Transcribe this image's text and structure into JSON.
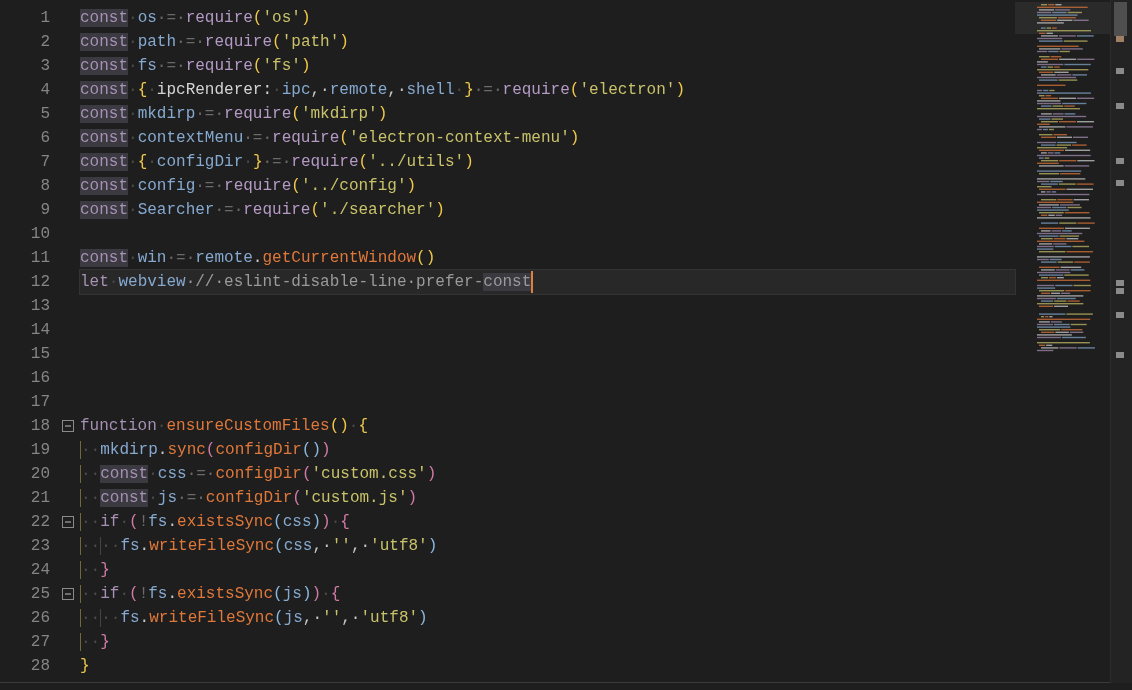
{
  "editor": {
    "lines": [
      {
        "number": "1",
        "fold": false,
        "current": false,
        "segments": [
          {
            "text": "const",
            "kind": "kw-match"
          },
          {
            "text": "·",
            "kind": "ws"
          },
          {
            "text": "os",
            "kind": "id"
          },
          {
            "text": "·=·",
            "kind": "op"
          },
          {
            "text": "require",
            "kind": "call"
          },
          {
            "text": "(",
            "kind": "p1"
          },
          {
            "text": "'os'",
            "kind": "str"
          },
          {
            "text": ")",
            "kind": "p1"
          }
        ]
      },
      {
        "number": "2",
        "fold": false,
        "current": false,
        "segments": [
          {
            "text": "const",
            "kind": "kw-match"
          },
          {
            "text": "·",
            "kind": "ws"
          },
          {
            "text": "path",
            "kind": "id"
          },
          {
            "text": "·=·",
            "kind": "op"
          },
          {
            "text": "require",
            "kind": "call"
          },
          {
            "text": "(",
            "kind": "p1"
          },
          {
            "text": "'path'",
            "kind": "str"
          },
          {
            "text": ")",
            "kind": "p1"
          }
        ]
      },
      {
        "number": "3",
        "fold": false,
        "current": false,
        "segments": [
          {
            "text": "const",
            "kind": "kw-match"
          },
          {
            "text": "·",
            "kind": "ws"
          },
          {
            "text": "fs",
            "kind": "id"
          },
          {
            "text": "·=·",
            "kind": "op"
          },
          {
            "text": "require",
            "kind": "call"
          },
          {
            "text": "(",
            "kind": "p1"
          },
          {
            "text": "'fs'",
            "kind": "str"
          },
          {
            "text": ")",
            "kind": "p1"
          }
        ]
      },
      {
        "number": "4",
        "fold": false,
        "current": false,
        "segments": [
          {
            "text": "const",
            "kind": "kw-match"
          },
          {
            "text": "·",
            "kind": "ws"
          },
          {
            "text": "{",
            "kind": "p1"
          },
          {
            "text": "·",
            "kind": "ws"
          },
          {
            "text": "ipcRenderer:",
            "kind": "prop"
          },
          {
            "text": "·",
            "kind": "ws"
          },
          {
            "text": "ipc",
            "kind": "id"
          },
          {
            "text": ",·",
            "kind": "punc"
          },
          {
            "text": "remote",
            "kind": "id"
          },
          {
            "text": ",·",
            "kind": "punc"
          },
          {
            "text": "shell",
            "kind": "id"
          },
          {
            "text": "·",
            "kind": "ws"
          },
          {
            "text": "}",
            "kind": "p1"
          },
          {
            "text": "·=·",
            "kind": "op"
          },
          {
            "text": "require",
            "kind": "call"
          },
          {
            "text": "(",
            "kind": "p1"
          },
          {
            "text": "'electron'",
            "kind": "str"
          },
          {
            "text": ")",
            "kind": "p1"
          }
        ]
      },
      {
        "number": "5",
        "fold": false,
        "current": false,
        "segments": [
          {
            "text": "const",
            "kind": "kw-match"
          },
          {
            "text": "·",
            "kind": "ws"
          },
          {
            "text": "mkdirp",
            "kind": "id"
          },
          {
            "text": "·=·",
            "kind": "op"
          },
          {
            "text": "require",
            "kind": "call"
          },
          {
            "text": "(",
            "kind": "p1"
          },
          {
            "text": "'mkdirp'",
            "kind": "str"
          },
          {
            "text": ")",
            "kind": "p1"
          }
        ]
      },
      {
        "number": "6",
        "fold": false,
        "current": false,
        "segments": [
          {
            "text": "const",
            "kind": "kw-match"
          },
          {
            "text": "·",
            "kind": "ws"
          },
          {
            "text": "contextMenu",
            "kind": "id"
          },
          {
            "text": "·=·",
            "kind": "op"
          },
          {
            "text": "require",
            "kind": "call"
          },
          {
            "text": "(",
            "kind": "p1"
          },
          {
            "text": "'electron-context-menu'",
            "kind": "str"
          },
          {
            "text": ")",
            "kind": "p1"
          }
        ]
      },
      {
        "number": "7",
        "fold": false,
        "current": false,
        "segments": [
          {
            "text": "const",
            "kind": "kw-match"
          },
          {
            "text": "·",
            "kind": "ws"
          },
          {
            "text": "{",
            "kind": "p1"
          },
          {
            "text": "·",
            "kind": "ws"
          },
          {
            "text": "configDir",
            "kind": "id"
          },
          {
            "text": "·",
            "kind": "ws"
          },
          {
            "text": "}",
            "kind": "p1"
          },
          {
            "text": "·=·",
            "kind": "op"
          },
          {
            "text": "require",
            "kind": "call"
          },
          {
            "text": "(",
            "kind": "p1"
          },
          {
            "text": "'../utils'",
            "kind": "str"
          },
          {
            "text": ")",
            "kind": "p1"
          }
        ]
      },
      {
        "number": "8",
        "fold": false,
        "current": false,
        "segments": [
          {
            "text": "const",
            "kind": "kw-match"
          },
          {
            "text": "·",
            "kind": "ws"
          },
          {
            "text": "config",
            "kind": "id"
          },
          {
            "text": "·=·",
            "kind": "op"
          },
          {
            "text": "require",
            "kind": "call"
          },
          {
            "text": "(",
            "kind": "p1"
          },
          {
            "text": "'../config'",
            "kind": "str"
          },
          {
            "text": ")",
            "kind": "p1"
          }
        ]
      },
      {
        "number": "9",
        "fold": false,
        "current": false,
        "segments": [
          {
            "text": "const",
            "kind": "kw-match"
          },
          {
            "text": "·",
            "kind": "ws"
          },
          {
            "text": "Searcher",
            "kind": "id"
          },
          {
            "text": "·=·",
            "kind": "op"
          },
          {
            "text": "require",
            "kind": "call"
          },
          {
            "text": "(",
            "kind": "p1"
          },
          {
            "text": "'./searcher'",
            "kind": "str"
          },
          {
            "text": ")",
            "kind": "p1"
          }
        ]
      },
      {
        "number": "10",
        "fold": false,
        "current": false
      },
      {
        "number": "11",
        "fold": false,
        "current": false,
        "segments": [
          {
            "text": "const",
            "kind": "kw-match"
          },
          {
            "text": "·",
            "kind": "ws"
          },
          {
            "text": "win",
            "kind": "id"
          },
          {
            "text": "·=·",
            "kind": "op"
          },
          {
            "text": "remote",
            "kind": "id"
          },
          {
            "text": ".",
            "kind": "punc"
          },
          {
            "text": "getCurrentWindow",
            "kind": "fn"
          },
          {
            "text": "()",
            "kind": "p1"
          }
        ]
      },
      {
        "number": "12",
        "fold": false,
        "current": true,
        "segments": [
          {
            "text": "let",
            "kind": "kw"
          },
          {
            "text": "·",
            "kind": "ws"
          },
          {
            "text": "webview",
            "kind": "id"
          },
          {
            "text": "·//·eslint-disable-line·prefer-",
            "kind": "comment"
          },
          {
            "text": "const",
            "kind": "comment-match"
          }
        ]
      },
      {
        "number": "13",
        "fold": false,
        "current": false
      },
      {
        "number": "14",
        "fold": false,
        "current": false
      },
      {
        "number": "15",
        "fold": false,
        "current": false
      },
      {
        "number": "16",
        "fold": false,
        "current": false
      },
      {
        "number": "17",
        "fold": false,
        "current": false
      },
      {
        "number": "18",
        "fold": true,
        "current": false,
        "segments": [
          {
            "text": "function",
            "kind": "kw"
          },
          {
            "text": "·",
            "kind": "ws"
          },
          {
            "text": "ensureCustomFiles",
            "kind": "fn"
          },
          {
            "text": "()",
            "kind": "p1"
          },
          {
            "text": "·",
            "kind": "ws"
          },
          {
            "text": "{",
            "kind": "p1"
          }
        ]
      },
      {
        "number": "19",
        "fold": false,
        "current": false,
        "segments": [
          {
            "text": "··",
            "kind": "indent-active"
          },
          {
            "text": "mkdirp",
            "kind": "id"
          },
          {
            "text": ".",
            "kind": "punc"
          },
          {
            "text": "sync",
            "kind": "fn"
          },
          {
            "text": "(",
            "kind": "p2"
          },
          {
            "text": "configDir",
            "kind": "fn"
          },
          {
            "text": "()",
            "kind": "p3"
          },
          {
            "text": ")",
            "kind": "p2"
          }
        ]
      },
      {
        "number": "20",
        "fold": false,
        "current": false,
        "segments": [
          {
            "text": "··",
            "kind": "indent-active"
          },
          {
            "text": "const",
            "kind": "kw-match"
          },
          {
            "text": "·",
            "kind": "ws"
          },
          {
            "text": "css",
            "kind": "id"
          },
          {
            "text": "·=·",
            "kind": "op"
          },
          {
            "text": "configDir",
            "kind": "fn"
          },
          {
            "text": "(",
            "kind": "p2"
          },
          {
            "text": "'custom.css'",
            "kind": "str"
          },
          {
            "text": ")",
            "kind": "p2"
          }
        ]
      },
      {
        "number": "21",
        "fold": false,
        "current": false,
        "segments": [
          {
            "text": "··",
            "kind": "indent-active"
          },
          {
            "text": "const",
            "kind": "kw-match"
          },
          {
            "text": "·",
            "kind": "ws"
          },
          {
            "text": "js",
            "kind": "id"
          },
          {
            "text": "·=·",
            "kind": "op"
          },
          {
            "text": "configDir",
            "kind": "fn"
          },
          {
            "text": "(",
            "kind": "p2"
          },
          {
            "text": "'custom.js'",
            "kind": "str"
          },
          {
            "text": ")",
            "kind": "p2"
          }
        ]
      },
      {
        "number": "22",
        "fold": true,
        "current": false,
        "segments": [
          {
            "text": "··",
            "kind": "indent-active"
          },
          {
            "text": "if",
            "kind": "kw"
          },
          {
            "text": "·",
            "kind": "ws"
          },
          {
            "text": "(",
            "kind": "p2"
          },
          {
            "text": "!",
            "kind": "op"
          },
          {
            "text": "fs",
            "kind": "id"
          },
          {
            "text": ".",
            "kind": "punc"
          },
          {
            "text": "existsSync",
            "kind": "fn"
          },
          {
            "text": "(",
            "kind": "p3"
          },
          {
            "text": "css",
            "kind": "id"
          },
          {
            "text": ")",
            "kind": "p3"
          },
          {
            "text": ")",
            "kind": "p2"
          },
          {
            "text": "·",
            "kind": "ws"
          },
          {
            "text": "{",
            "kind": "p2"
          }
        ]
      },
      {
        "number": "23",
        "fold": false,
        "current": false,
        "segments": [
          {
            "text": "··",
            "kind": "indent-active"
          },
          {
            "text": "··",
            "kind": "indent"
          },
          {
            "text": "fs",
            "kind": "id"
          },
          {
            "text": ".",
            "kind": "punc"
          },
          {
            "text": "writeFileSync",
            "kind": "fn"
          },
          {
            "text": "(",
            "kind": "p3"
          },
          {
            "text": "css",
            "kind": "id"
          },
          {
            "text": ",·",
            "kind": "punc"
          },
          {
            "text": "''",
            "kind": "str"
          },
          {
            "text": ",·",
            "kind": "punc"
          },
          {
            "text": "'utf8'",
            "kind": "str"
          },
          {
            "text": ")",
            "kind": "p3"
          }
        ]
      },
      {
        "number": "24",
        "fold": false,
        "current": false,
        "segments": [
          {
            "text": "··",
            "kind": "indent-active"
          },
          {
            "text": "}",
            "kind": "p2"
          }
        ]
      },
      {
        "number": "25",
        "fold": true,
        "current": false,
        "segments": [
          {
            "text": "··",
            "kind": "indent-active"
          },
          {
            "text": "if",
            "kind": "kw"
          },
          {
            "text": "·",
            "kind": "ws"
          },
          {
            "text": "(",
            "kind": "p2"
          },
          {
            "text": "!",
            "kind": "op"
          },
          {
            "text": "fs",
            "kind": "id"
          },
          {
            "text": ".",
            "kind": "punc"
          },
          {
            "text": "existsSync",
            "kind": "fn"
          },
          {
            "text": "(",
            "kind": "p3"
          },
          {
            "text": "js",
            "kind": "id"
          },
          {
            "text": ")",
            "kind": "p3"
          },
          {
            "text": ")",
            "kind": "p2"
          },
          {
            "text": "·",
            "kind": "ws"
          },
          {
            "text": "{",
            "kind": "p2"
          }
        ]
      },
      {
        "number": "26",
        "fold": false,
        "current": false,
        "segments": [
          {
            "text": "··",
            "kind": "indent-active"
          },
          {
            "text": "··",
            "kind": "indent"
          },
          {
            "text": "fs",
            "kind": "id"
          },
          {
            "text": ".",
            "kind": "punc"
          },
          {
            "text": "writeFileSync",
            "kind": "fn"
          },
          {
            "text": "(",
            "kind": "p3"
          },
          {
            "text": "js",
            "kind": "id"
          },
          {
            "text": ",·",
            "kind": "punc"
          },
          {
            "text": "''",
            "kind": "str"
          },
          {
            "text": ",·",
            "kind": "punc"
          },
          {
            "text": "'utf8'",
            "kind": "str"
          },
          {
            "text": ")",
            "kind": "p3"
          }
        ]
      },
      {
        "number": "27",
        "fold": false,
        "current": false,
        "segments": [
          {
            "text": "··",
            "kind": "indent-active"
          },
          {
            "text": "}",
            "kind": "p2"
          }
        ]
      },
      {
        "number": "28",
        "fold": false,
        "current": false,
        "segments": [
          {
            "text": "}",
            "kind": "p1"
          }
        ]
      }
    ]
  }
}
